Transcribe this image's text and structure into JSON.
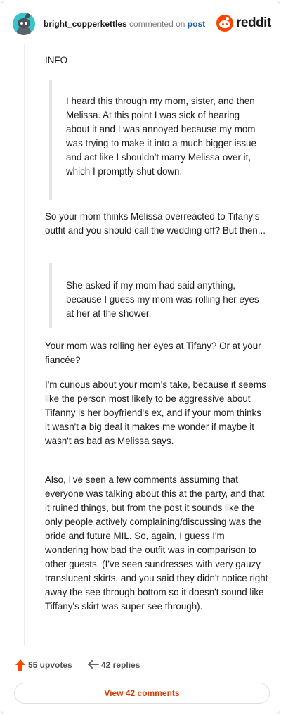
{
  "header": {
    "username": "bright_copperkettles",
    "commented_on": "commented on",
    "post_link": "post",
    "brand": "reddit"
  },
  "comment": {
    "info": "INFO",
    "quote1": "I heard this through my mom, sister, and then Melissa. At this point I was sick of hearing about it and I was annoyed because my mom was trying to make it into a much bigger issue and act like I shouldn't marry Melissa over it, which I promptly shut down.",
    "para2": "So your mom thinks Melissa overreacted to Tifany's outfit and you should call the wedding off? But then...",
    "quote2": "She asked if my mom had said anything, because I guess my mom was rolling her eyes at her at the shower.",
    "para3": "Your mom was rolling her eyes at Tifany? Or at your fiancée?",
    "para4": "I'm curious about your mom's take, because it seems like the person most likely to be aggressive about Tifanny is her boyfriend's ex, and if your mom thinks it wasn't a big deal it makes me wonder if maybe it wasn't as bad as Melissa says.",
    "para5": "Also, I've seen a few comments assuming that everyone was talking about this at the party, and that it ruined things, but from the post it sounds like the only people actively complaining/discussing was the bride and future MIL. So, again, I guess I'm wondering how bad the outfit was in comparison to other guests. (I've seen sundresses with very gauzy translucent skirts, and you said they didn't notice right away the see through bottom so it doesn't sound like Tiffany's skirt was super see through)."
  },
  "actions": {
    "upvotes": "55 upvotes",
    "replies": "42 replies"
  },
  "footer": {
    "view_comments": "View 42 comments"
  },
  "colors": {
    "accent": "#ff4500",
    "link": "#1a5fb4",
    "button_text": "#d93a00"
  },
  "icons": [
    "avatar",
    "reddit-logo-icon",
    "upvote-arrow-icon",
    "reply-arrow-icon"
  ]
}
